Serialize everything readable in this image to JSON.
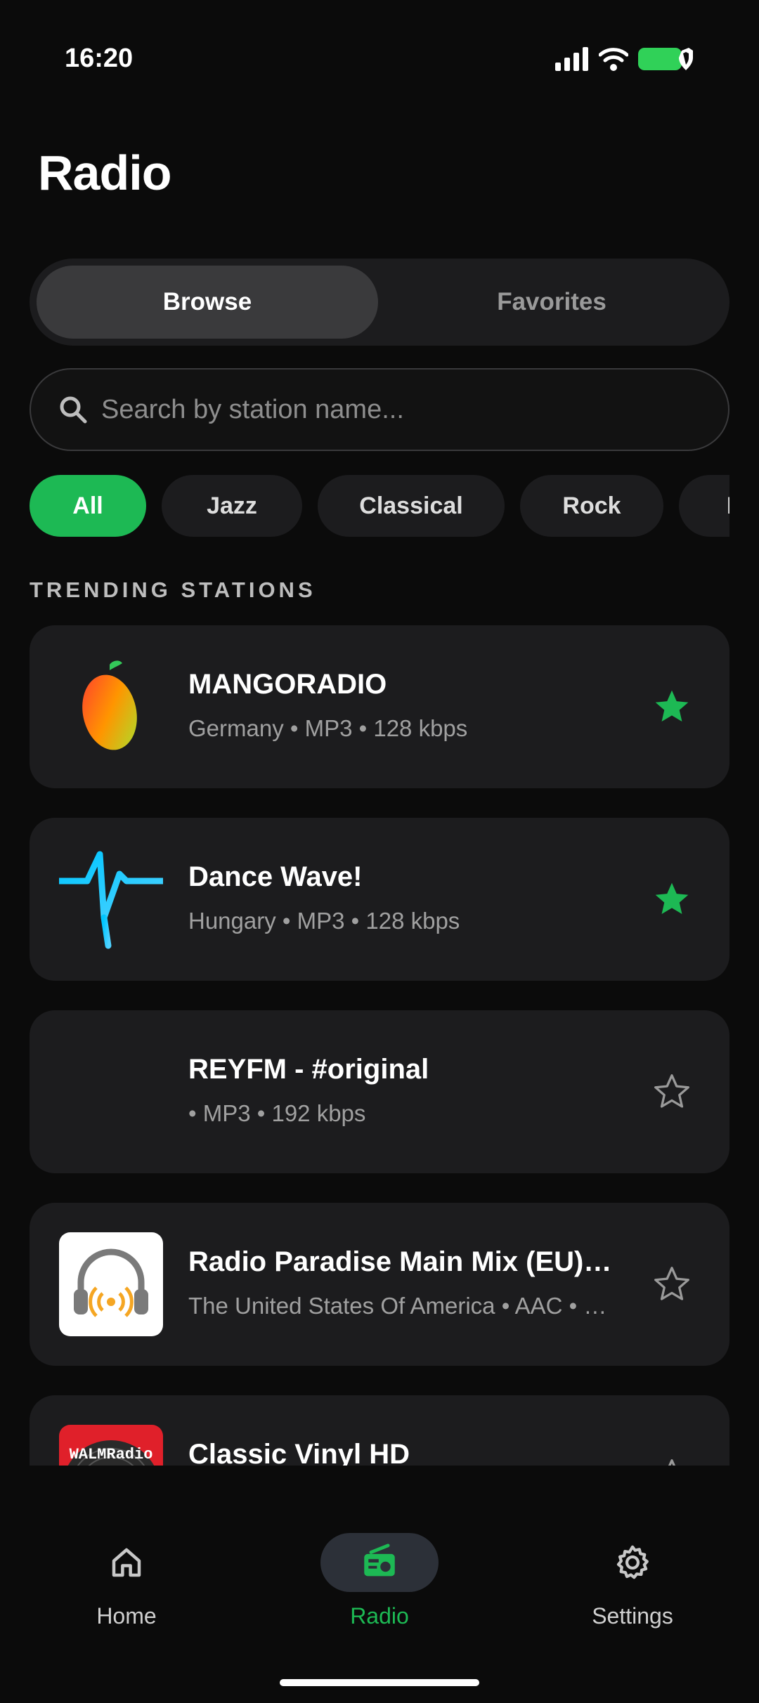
{
  "status_bar": {
    "time": "16:20"
  },
  "page": {
    "title": "Radio"
  },
  "segmented": {
    "browse": "Browse",
    "favorites": "Favorites"
  },
  "search": {
    "placeholder": "Search by station name..."
  },
  "chips": [
    "All",
    "Jazz",
    "Classical",
    "Rock",
    "Pop"
  ],
  "section": {
    "label": "TRENDING STATIONS"
  },
  "stations": [
    {
      "name": "MANGORADIO",
      "meta": "Germany • MP3 • 128 kbps",
      "favorite": true,
      "logo": "mango-logo"
    },
    {
      "name": "Dance Wave!",
      "meta": "Hungary • MP3 • 128 kbps",
      "favorite": true,
      "logo": "wave-logo"
    },
    {
      "name": "REYFM - #original",
      "meta": " • MP3 • 192 kbps",
      "favorite": false,
      "logo": "none"
    },
    {
      "name": "Radio Paradise Main Mix (EU) …",
      "meta": "The United States Of America • AAC • …",
      "favorite": false,
      "logo": "headphones-logo"
    },
    {
      "name": "Classic Vinyl HD",
      "meta": "",
      "favorite": false,
      "logo": "walmradio-logo",
      "logo_text": "WALMRadio"
    }
  ],
  "nav": {
    "home": "Home",
    "radio": "Radio",
    "settings": "Settings"
  },
  "colors": {
    "accent": "#1db954",
    "background": "#0b0b0b",
    "card": "#1c1c1e"
  }
}
